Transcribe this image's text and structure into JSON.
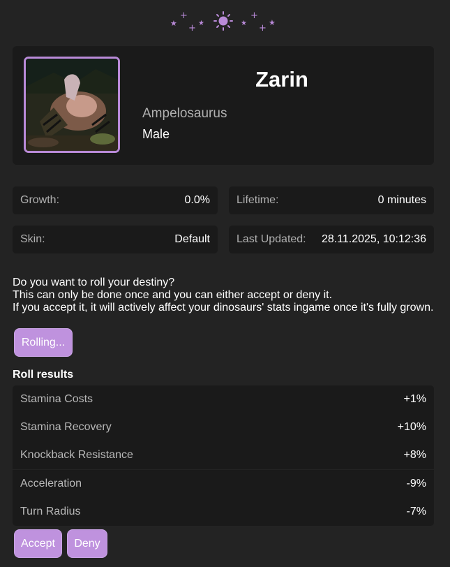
{
  "header": {
    "decoration": [
      "sparkle-icon",
      "sun-icon",
      "sparkle-icon"
    ],
    "accent": "#b98ad8"
  },
  "profile": {
    "name": "Zarin",
    "species": "Ampelosaurus",
    "sex": "Male"
  },
  "stats": [
    {
      "label": "Growth:",
      "value": "0.0%"
    },
    {
      "label": "Lifetime:",
      "value": "0 minutes"
    },
    {
      "label": "Skin:",
      "value": "Default"
    },
    {
      "label": "Last Updated:",
      "value": "28.11.2025, 10:12:36"
    }
  ],
  "destiny": {
    "line1": "Do you want to roll your destiny?",
    "line2": "This can only be done once and you can either accept or deny it.",
    "line3": "If you accept it, it will actively affect your dinosaurs' stats ingame once it's fully grown.",
    "roll_button": "Rolling..."
  },
  "results": {
    "title": "Roll results",
    "rows": [
      {
        "label": "Stamina Costs",
        "value": "+1%"
      },
      {
        "label": "Stamina Recovery",
        "value": "+10%"
      },
      {
        "label": "Knockback Resistance",
        "value": "+8%"
      },
      {
        "label": "Acceleration",
        "value": "-9%"
      },
      {
        "label": "Turn Radius",
        "value": "-7%"
      }
    ],
    "accept_button": "Accept",
    "deny_button": "Deny"
  },
  "colors": {
    "background": "#232323",
    "card": "#1a1a1a",
    "button": "#bf92de"
  }
}
